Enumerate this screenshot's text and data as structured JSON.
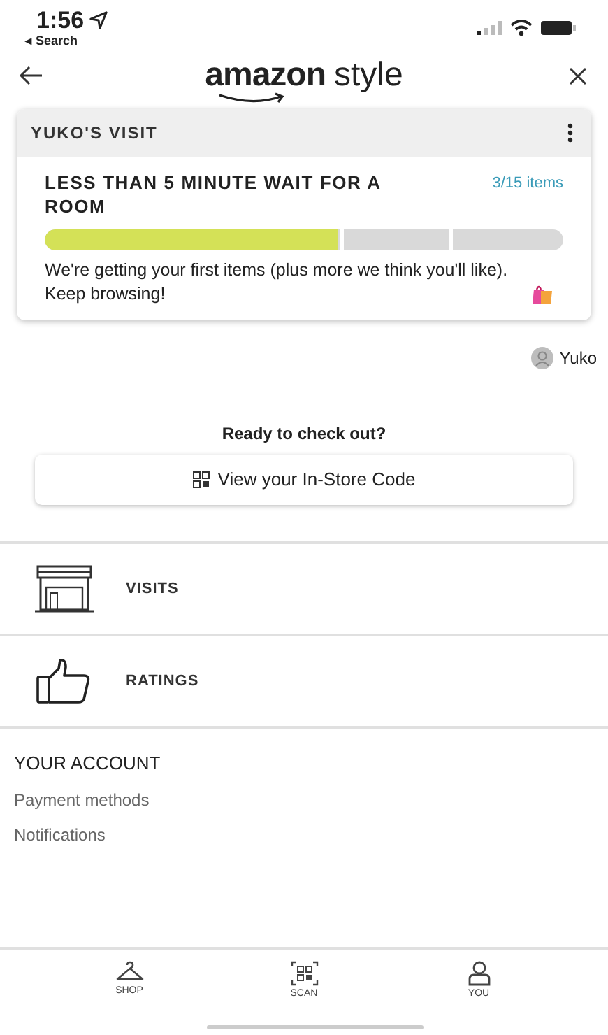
{
  "status_bar": {
    "time": "1:56",
    "back_label": "◂ Search"
  },
  "header": {
    "logo_word": "amazon",
    "logo_suffix": "style"
  },
  "visit_card": {
    "title": "YUKO'S VISIT",
    "status": "LESS THAN 5 MINUTE WAIT FOR A ROOM",
    "count": "3/15 items",
    "progress": {
      "level": 0.565
    },
    "message": "We're getting your first items (plus more we think you'll like). Keep browsing!"
  },
  "user": {
    "name": "Yuko"
  },
  "checkout": {
    "prompt": "Ready to check out?",
    "button": "View your In-Store Code"
  },
  "menu": [
    {
      "kind": "store",
      "label": "VISITS"
    },
    {
      "kind": "thumb",
      "label": "RATINGS"
    }
  ],
  "account": {
    "heading": "YOUR ACCOUNT",
    "links": [
      "Payment methods",
      "Notifications"
    ]
  },
  "tab_bar": [
    {
      "kind": "hanger",
      "label": "SHOP"
    },
    {
      "kind": "scan",
      "label": "SCAN"
    },
    {
      "kind": "person",
      "label": "YOU"
    }
  ]
}
